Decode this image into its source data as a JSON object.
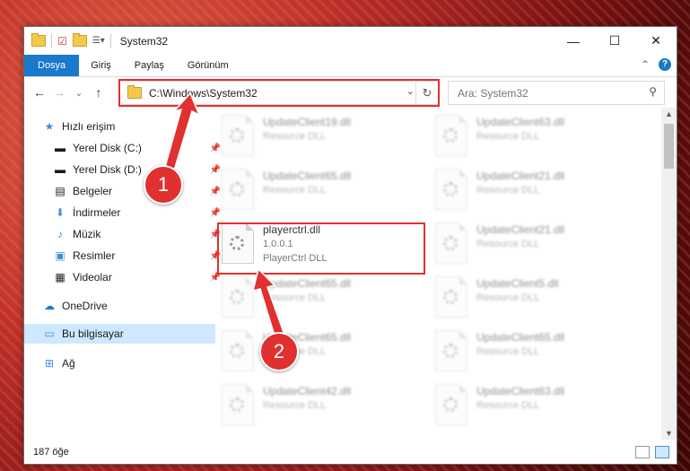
{
  "window": {
    "title": "System32",
    "minimize": "—",
    "maximize": "☐",
    "close": "✕"
  },
  "ribbon": {
    "tabs": [
      "Dosya",
      "Giriş",
      "Paylaş",
      "Görünüm"
    ],
    "collapse": "⌃",
    "help": "?"
  },
  "navigation": {
    "back": "←",
    "forward": "→",
    "recent": "⌄",
    "up": "↑"
  },
  "address": {
    "path": "C:\\Windows\\System32",
    "dropdown": "⌄",
    "refresh": "↻"
  },
  "search": {
    "placeholder": "Ara: System32"
  },
  "sidebar": {
    "items": [
      {
        "label": "Hızlı erişim",
        "icon": "star-icon",
        "pinned": false
      },
      {
        "label": "Yerel Disk (C:)",
        "icon": "drive-icon",
        "pinned": true
      },
      {
        "label": "Yerel Disk (D:)",
        "icon": "drive-icon",
        "pinned": true
      },
      {
        "label": "Belgeler",
        "icon": "documents-icon",
        "pinned": true
      },
      {
        "label": "İndirmeler",
        "icon": "download-icon",
        "pinned": true
      },
      {
        "label": "Müzik",
        "icon": "music-icon",
        "pinned": true
      },
      {
        "label": "Resimler",
        "icon": "pictures-icon",
        "pinned": true
      },
      {
        "label": "Videolar",
        "icon": "videos-icon",
        "pinned": true
      },
      {
        "label": "OneDrive",
        "icon": "cloud-icon",
        "pinned": false
      },
      {
        "label": "Bu bilgisayar",
        "icon": "computer-icon",
        "pinned": false,
        "selected": true
      },
      {
        "label": "Ağ",
        "icon": "network-icon",
        "pinned": false
      }
    ]
  },
  "files": [
    {
      "name": "UpdateClient19.dll",
      "desc": "Resource DLL",
      "blurred": true
    },
    {
      "name": "UpdateClient63.dll",
      "desc": "Resource DLL",
      "blurred": true
    },
    {
      "name": "UpdateClient65.dll",
      "desc": "Resource DLL",
      "blurred": true
    },
    {
      "name": "UpdateClient21.dll",
      "desc": "Resource DLL",
      "blurred": true
    },
    {
      "name": "playerctrl.dll",
      "version": "1.0.0.1",
      "desc": "PlayerCtrl DLL",
      "blurred": false
    },
    {
      "name": "UpdateClient21.dll",
      "desc": "Resource DLL",
      "blurred": true
    },
    {
      "name": "UpdateClient65.dll",
      "desc": "Resource DLL",
      "blurred": true
    },
    {
      "name": "UpdateClient5.dll",
      "desc": "Resource DLL",
      "blurred": true
    },
    {
      "name": "UpdateClient65.dll",
      "desc": "Resource DLL",
      "blurred": true
    },
    {
      "name": "UpdateClient65.dll",
      "desc": "Resource DLL",
      "blurred": true
    },
    {
      "name": "UpdateClient42.dll",
      "desc": "Resource DLL",
      "blurred": true
    },
    {
      "name": "UpdateClient63.dll",
      "desc": "Resource DLL",
      "blurred": true
    }
  ],
  "status": {
    "count": "187 öğe"
  },
  "callouts": [
    "1",
    "2"
  ],
  "colors": {
    "accent": "#1979ca",
    "highlight": "#e0302f",
    "selected": "#cde8ff"
  }
}
